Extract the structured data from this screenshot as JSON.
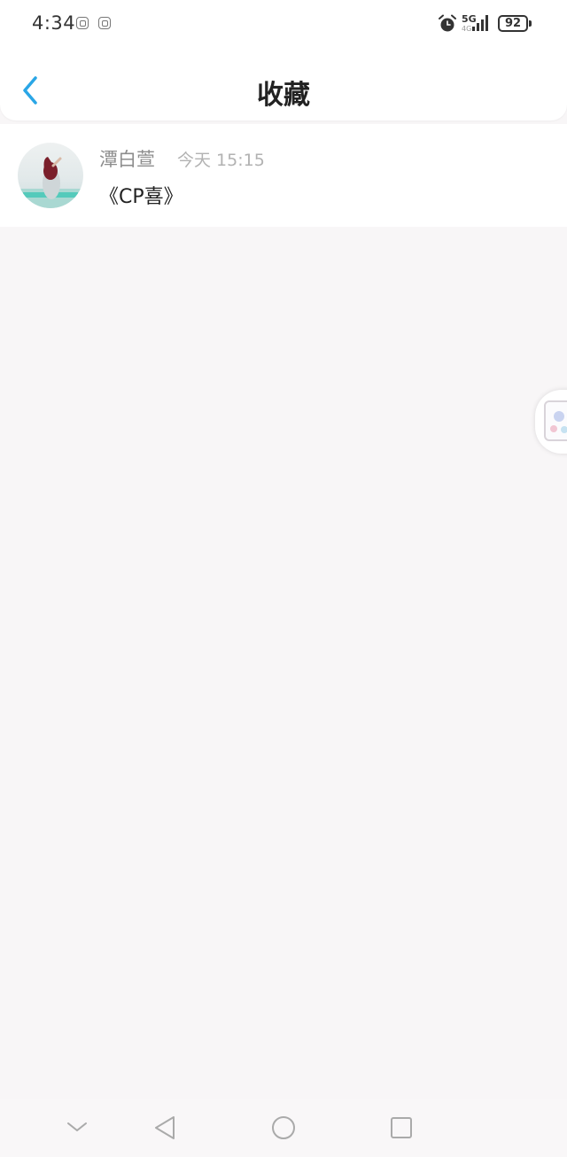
{
  "status_bar": {
    "time": "4:34",
    "network_top": "5G",
    "network_bottom": "4G",
    "battery": "92"
  },
  "header": {
    "title": "收藏",
    "back_icon": "chevron-left-icon"
  },
  "favorites": [
    {
      "username": "潭白萱",
      "date": "今天 15:15",
      "content": "《CP喜》"
    }
  ],
  "colors": {
    "accent": "#2aa6e6",
    "background": "#f8f6f7",
    "username": "#8d8d8d",
    "date": "#b2b2b2"
  },
  "nav_bar": {
    "icons": [
      "chevron-down-icon",
      "back-triangle-icon",
      "home-circle-icon",
      "recent-square-icon"
    ]
  }
}
